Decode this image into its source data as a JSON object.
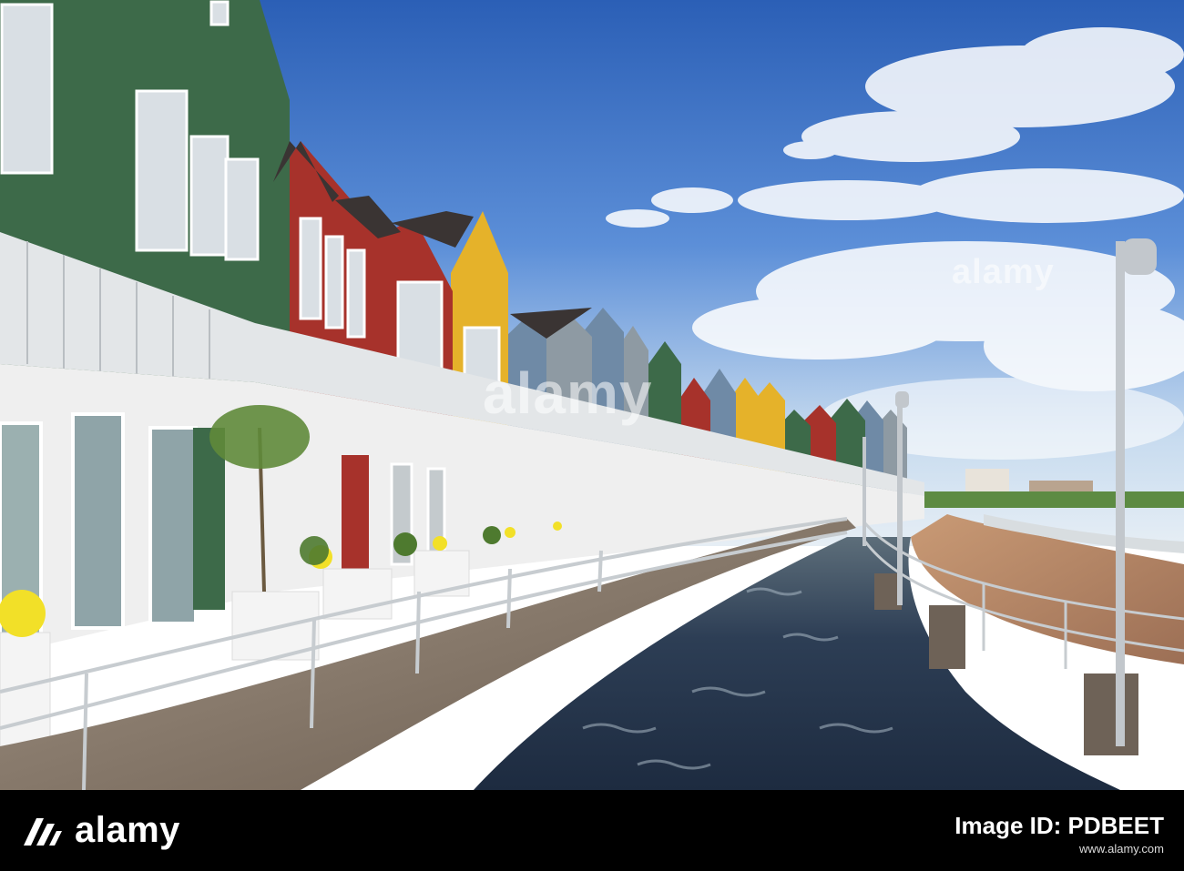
{
  "scene": {
    "description_colors": {
      "sky_top": "#2f63b8",
      "sky_mid": "#5d8ed8",
      "sky_low": "#cfe0f2",
      "water": "#27384f",
      "boardwalk": "#8a7c6c",
      "path": "#b58a6e",
      "house_green": "#3d6a49",
      "house_red": "#a7322b",
      "house_yellow": "#e5b22a",
      "house_blue": "#6f8aa6",
      "house_grey": "#8e9aa3",
      "railing": "#dfe3e6"
    }
  },
  "watermarks": {
    "center": "alamy",
    "right": "alamy"
  },
  "footer": {
    "logo_text": "alamy",
    "image_id_label": "Image ID: PDBEET",
    "image_id": "",
    "url": "www.alamy.com",
    "background": "#000000"
  }
}
